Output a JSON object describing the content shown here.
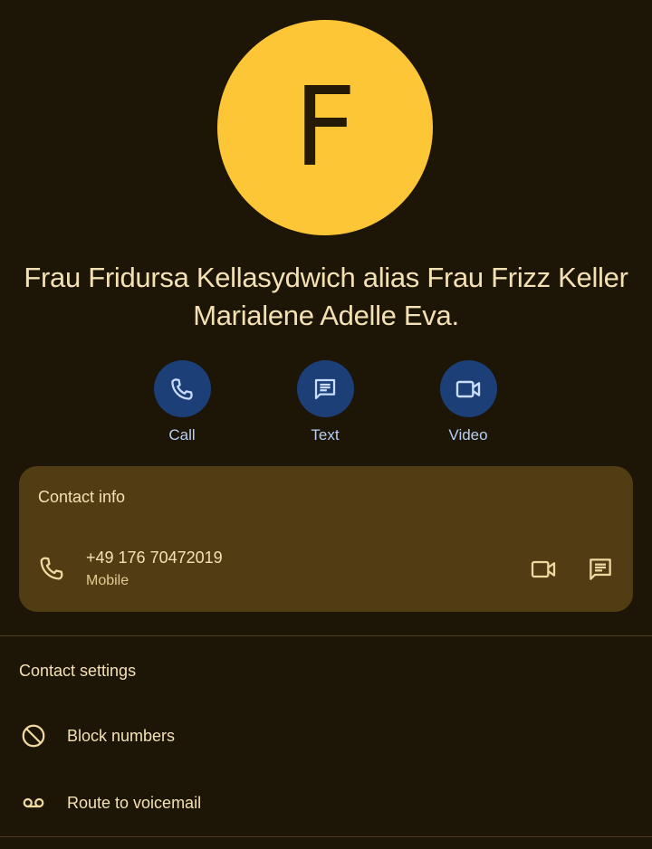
{
  "contact": {
    "initial": "F",
    "name_line1": "Frau Fridursa Kellasydwich alias Frau Frizz Keller",
    "name_line2": "Marialene Adelle Eva."
  },
  "actions": [
    {
      "label": "Call",
      "icon": "phone-icon"
    },
    {
      "label": "Text",
      "icon": "message-icon"
    },
    {
      "label": "Video",
      "icon": "video-icon"
    }
  ],
  "contact_info": {
    "title": "Contact info",
    "phone": {
      "number": "+49 176 70472019",
      "type": "Mobile"
    }
  },
  "contact_settings": {
    "title": "Contact settings",
    "items": [
      {
        "label": "Block numbers",
        "icon": "block-icon"
      },
      {
        "label": "Route to voicemail",
        "icon": "voicemail-icon"
      }
    ]
  },
  "colors": {
    "background": "#1d1506",
    "avatar": "#fdc637",
    "action_circle": "#1c3f78",
    "card": "#523c14",
    "text": "#f3e1b3",
    "action_label": "#b7cff5"
  }
}
